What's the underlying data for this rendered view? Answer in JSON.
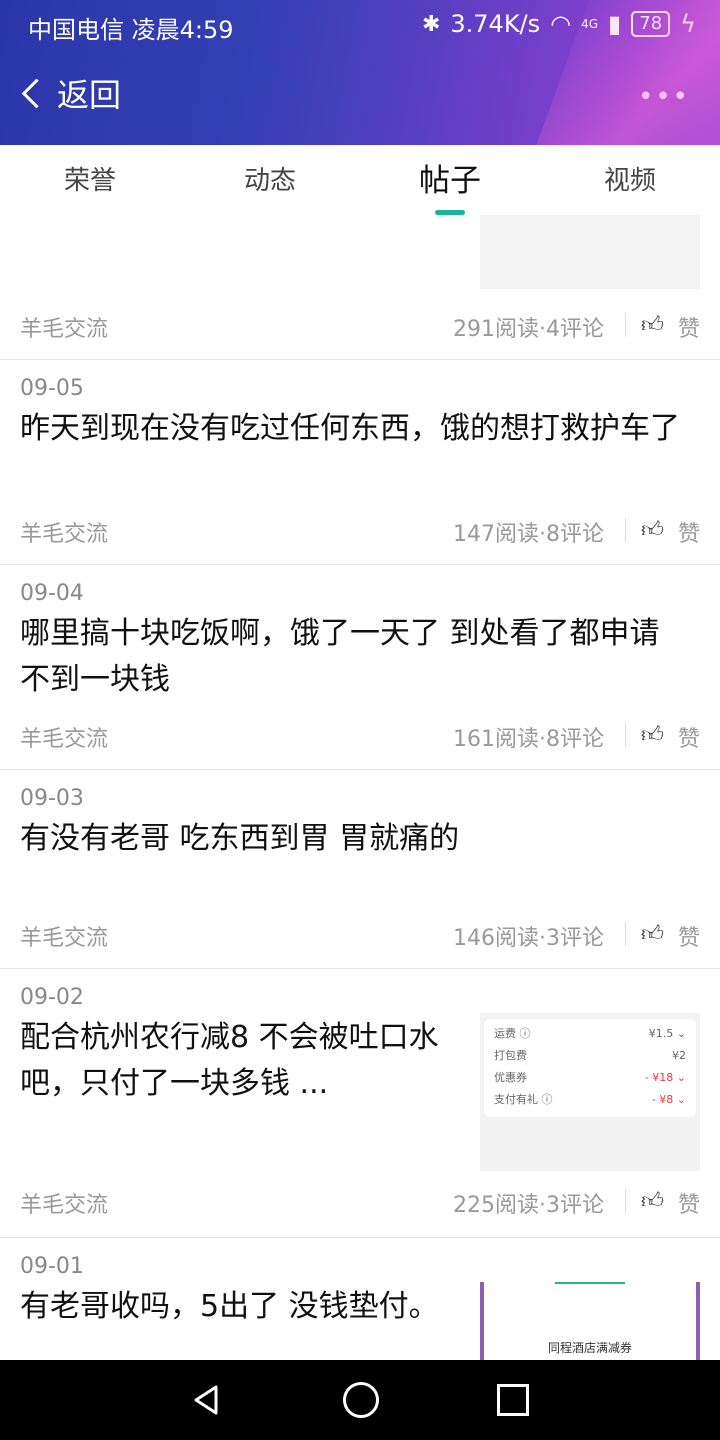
{
  "status_bar": {
    "carrier_time": "中国电信 凌晨4:59",
    "speed": "3.74K/s",
    "network": "4G",
    "battery": "78"
  },
  "nav": {
    "back_label": "返回",
    "more_label": "•••"
  },
  "tabs": [
    {
      "label": "荣誉"
    },
    {
      "label": "动态"
    },
    {
      "label": "帖子"
    },
    {
      "label": "视频"
    }
  ],
  "posts": [
    {
      "category": "羊毛交流",
      "stats": "291阅读·4评论",
      "like": "赞"
    },
    {
      "date": "09-05",
      "title": "昨天到现在没有吃过任何东西，饿的想打救护车了",
      "category": "羊毛交流",
      "stats": "147阅读·8评论",
      "like": "赞"
    },
    {
      "date": "09-04",
      "title": "哪里搞十块吃饭啊，饿了一天了  到处看了都申请不到一块钱",
      "category": "羊毛交流",
      "stats": "161阅读·8评论",
      "like": "赞"
    },
    {
      "date": "09-03",
      "title": "有没有老哥 吃东西到胃 胃就痛的",
      "category": "羊毛交流",
      "stats": "146阅读·3评论",
      "like": "赞"
    },
    {
      "date": "09-02",
      "title": "配合杭州农行减8  不会被吐口水吧，只付了一块多钱 ...",
      "category": "羊毛交流",
      "stats": "225阅读·3评论",
      "like": "赞",
      "thumb_rows": [
        {
          "label": "运费 ⓘ",
          "value": "¥1.5 ⌄"
        },
        {
          "label": "打包费",
          "value": "¥2"
        },
        {
          "label": "优惠券",
          "value": "- ¥18 ⌄"
        },
        {
          "label": "支付有礼 ⓘ",
          "value": "- ¥8 ⌄"
        }
      ]
    },
    {
      "date": "09-01",
      "title": "有老哥收吗，5出了  没钱垫付。",
      "thumb_text": "同程酒店满减券"
    }
  ]
}
